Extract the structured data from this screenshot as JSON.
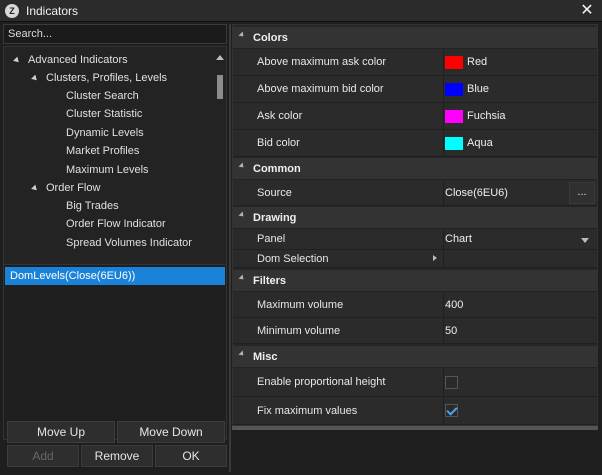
{
  "window": {
    "title": "Indicators",
    "logo_glyph": "Z"
  },
  "left_panel": {
    "search_placeholder": "Search...",
    "tree": [
      {
        "label": "Advanced Indicators",
        "level": 0,
        "expanded": true
      },
      {
        "label": "Clusters, Profiles, Levels",
        "level": 1,
        "expanded": true
      },
      {
        "label": "Cluster Search",
        "level": 2
      },
      {
        "label": "Cluster Statistic",
        "level": 2
      },
      {
        "label": "Dynamic Levels",
        "level": 2
      },
      {
        "label": "Market Profiles",
        "level": 2
      },
      {
        "label": "Maximum Levels",
        "level": 2
      },
      {
        "label": "Order Flow",
        "level": 1,
        "expanded": true
      },
      {
        "label": "Big Trades",
        "level": 2
      },
      {
        "label": "Order Flow Indicator",
        "level": 2
      },
      {
        "label": "Spread Volumes Indicator",
        "level": 2
      }
    ],
    "selected_indicators": [
      "DomLevels(Close(6EU6))"
    ],
    "buttons": {
      "move_up": "Move Up",
      "move_down": "Move Down",
      "add": "Add",
      "remove": "Remove",
      "ok": "OK"
    }
  },
  "properties": {
    "categories": [
      {
        "name": "Colors",
        "rows": [
          {
            "name": "Above maximum ask color",
            "value": "Red",
            "swatch": "#ff0000"
          },
          {
            "name": "Above maximum bid color",
            "value": "Blue",
            "swatch": "#0000ff"
          },
          {
            "name": "Ask color",
            "value": "Fuchsia",
            "swatch": "#ff00ff"
          },
          {
            "name": "Bid color",
            "value": "Aqua",
            "swatch": "#00ffff"
          }
        ]
      },
      {
        "name": "Common",
        "rows": [
          {
            "name": "Source",
            "value": "Close(6EU6)",
            "button": "..."
          }
        ]
      },
      {
        "name": "Drawing",
        "rows": [
          {
            "name": "Panel",
            "value": "Chart",
            "dropdown": true
          },
          {
            "name": "Dom Selection",
            "value": "",
            "expandable": true
          }
        ]
      },
      {
        "name": "Filters",
        "rows": [
          {
            "name": "Maximum volume",
            "value": "400"
          },
          {
            "name": "Minimum volume",
            "value": "50"
          }
        ]
      },
      {
        "name": "Misc",
        "rows": [
          {
            "name": "Enable proportional height",
            "checked": false
          },
          {
            "name": "Fix maximum values",
            "checked": true
          }
        ]
      }
    ]
  }
}
